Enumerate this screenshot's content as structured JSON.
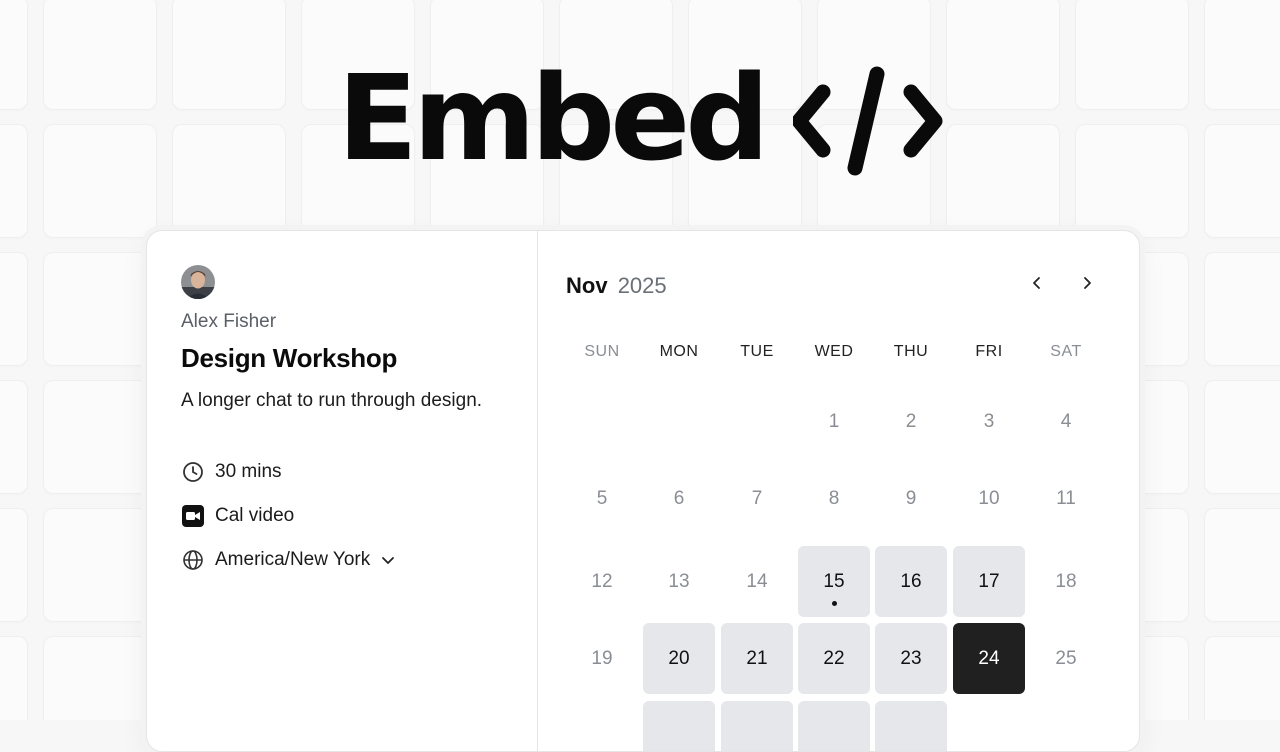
{
  "hero": {
    "title": "Embed",
    "icon": "code-brackets-icon"
  },
  "booking": {
    "host_name": "Alex Fisher",
    "event_title": "Design Workshop",
    "description": "A longer chat to run through design.",
    "duration": "30 mins",
    "location": "Cal video",
    "timezone": "America/New York"
  },
  "calendar": {
    "month": "Nov",
    "year": "2025",
    "weekdays": [
      "SUN",
      "MON",
      "TUE",
      "WED",
      "THU",
      "FRI",
      "SAT"
    ],
    "rows": [
      [
        "",
        "",
        "",
        "1",
        "2",
        "3",
        "4"
      ],
      [
        "5",
        "6",
        "7",
        "8",
        "9",
        "10",
        "11"
      ],
      [
        "12",
        "13",
        "14",
        "15",
        "16",
        "17",
        "18"
      ],
      [
        "19",
        "20",
        "21",
        "22",
        "23",
        "24",
        "25"
      ]
    ],
    "available_days": [
      "15",
      "16",
      "17",
      "20",
      "21",
      "22",
      "23",
      "24"
    ],
    "selected_day": "24",
    "today": "15"
  },
  "colors": {
    "available_bg": "#e5e7eb",
    "selected_bg": "#202020",
    "muted_text": "#8a8e94"
  }
}
